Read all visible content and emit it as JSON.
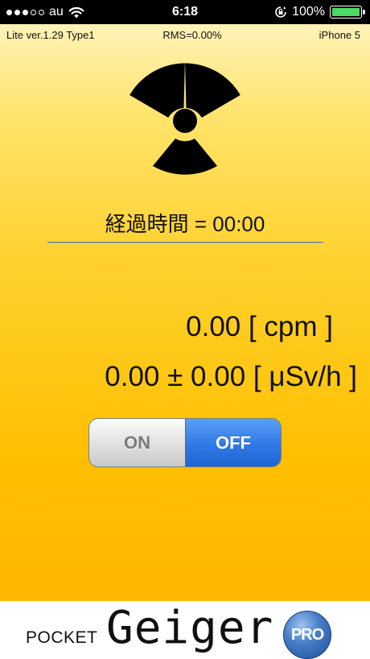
{
  "status_bar": {
    "carrier": "au",
    "time": "6:18",
    "battery_percent": "100%",
    "battery_level": 1.0,
    "signal_filled_dots": 3,
    "signal_total_dots": 5
  },
  "info": {
    "version": "Lite ver.1.29 Type1",
    "rms": "RMS=0.00%",
    "device": "iPhone 5"
  },
  "elapsed": {
    "text": "経過時間 = 00:00"
  },
  "readings": {
    "cpm": "0.00 [ cpm ]",
    "dose": "0.00 ± 0.00 [ μSv/h ]"
  },
  "switch": {
    "on_label": "ON",
    "off_label": "OFF",
    "selected": "OFF"
  },
  "brand": {
    "pocket": "POCKET",
    "geiger": "Geiger",
    "badge": "PRO"
  },
  "colors": {
    "background_top": "#fff7cc",
    "background_bottom": "#ffb300",
    "switch_off_active": "#3079e6",
    "battery_fill": "#4cd964",
    "badge": "#1c4f9a"
  }
}
